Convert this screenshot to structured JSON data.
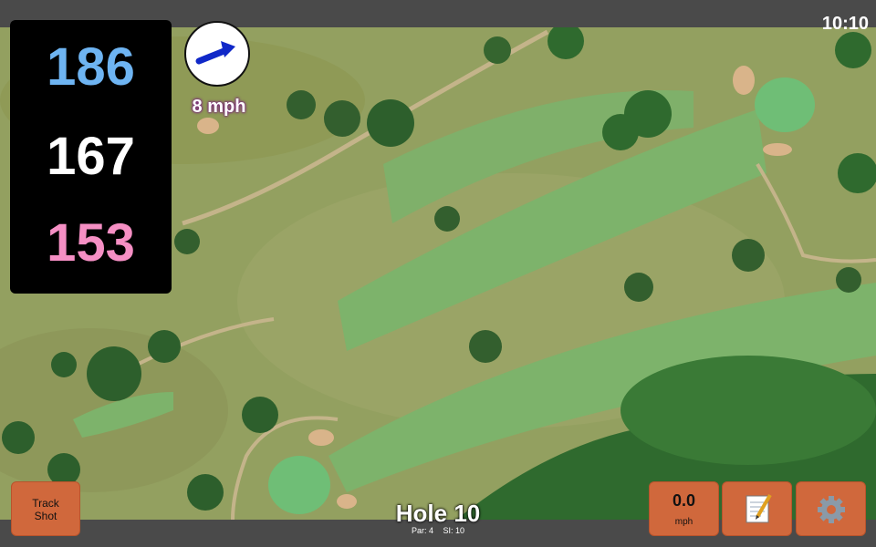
{
  "status": {
    "time": "10:10"
  },
  "distances": {
    "back": "186",
    "center": "167",
    "front": "153"
  },
  "wind": {
    "speed": "8 mph",
    "direction_icon": "arrow-right-icon"
  },
  "buttons": {
    "track_shot_line1": "Track",
    "track_shot_line2": "Shot",
    "speed_value": "0.0",
    "speed_unit": "mph",
    "notes_icon": "notepad-icon",
    "settings_icon": "gear-icon"
  },
  "hole": {
    "title": "Hole 10",
    "par": "Par: 4",
    "si": "SI: 10"
  },
  "colors": {
    "back": "#6eb4f2",
    "center": "#ffffff",
    "front": "#f58fc4",
    "button": "#d0683c"
  }
}
